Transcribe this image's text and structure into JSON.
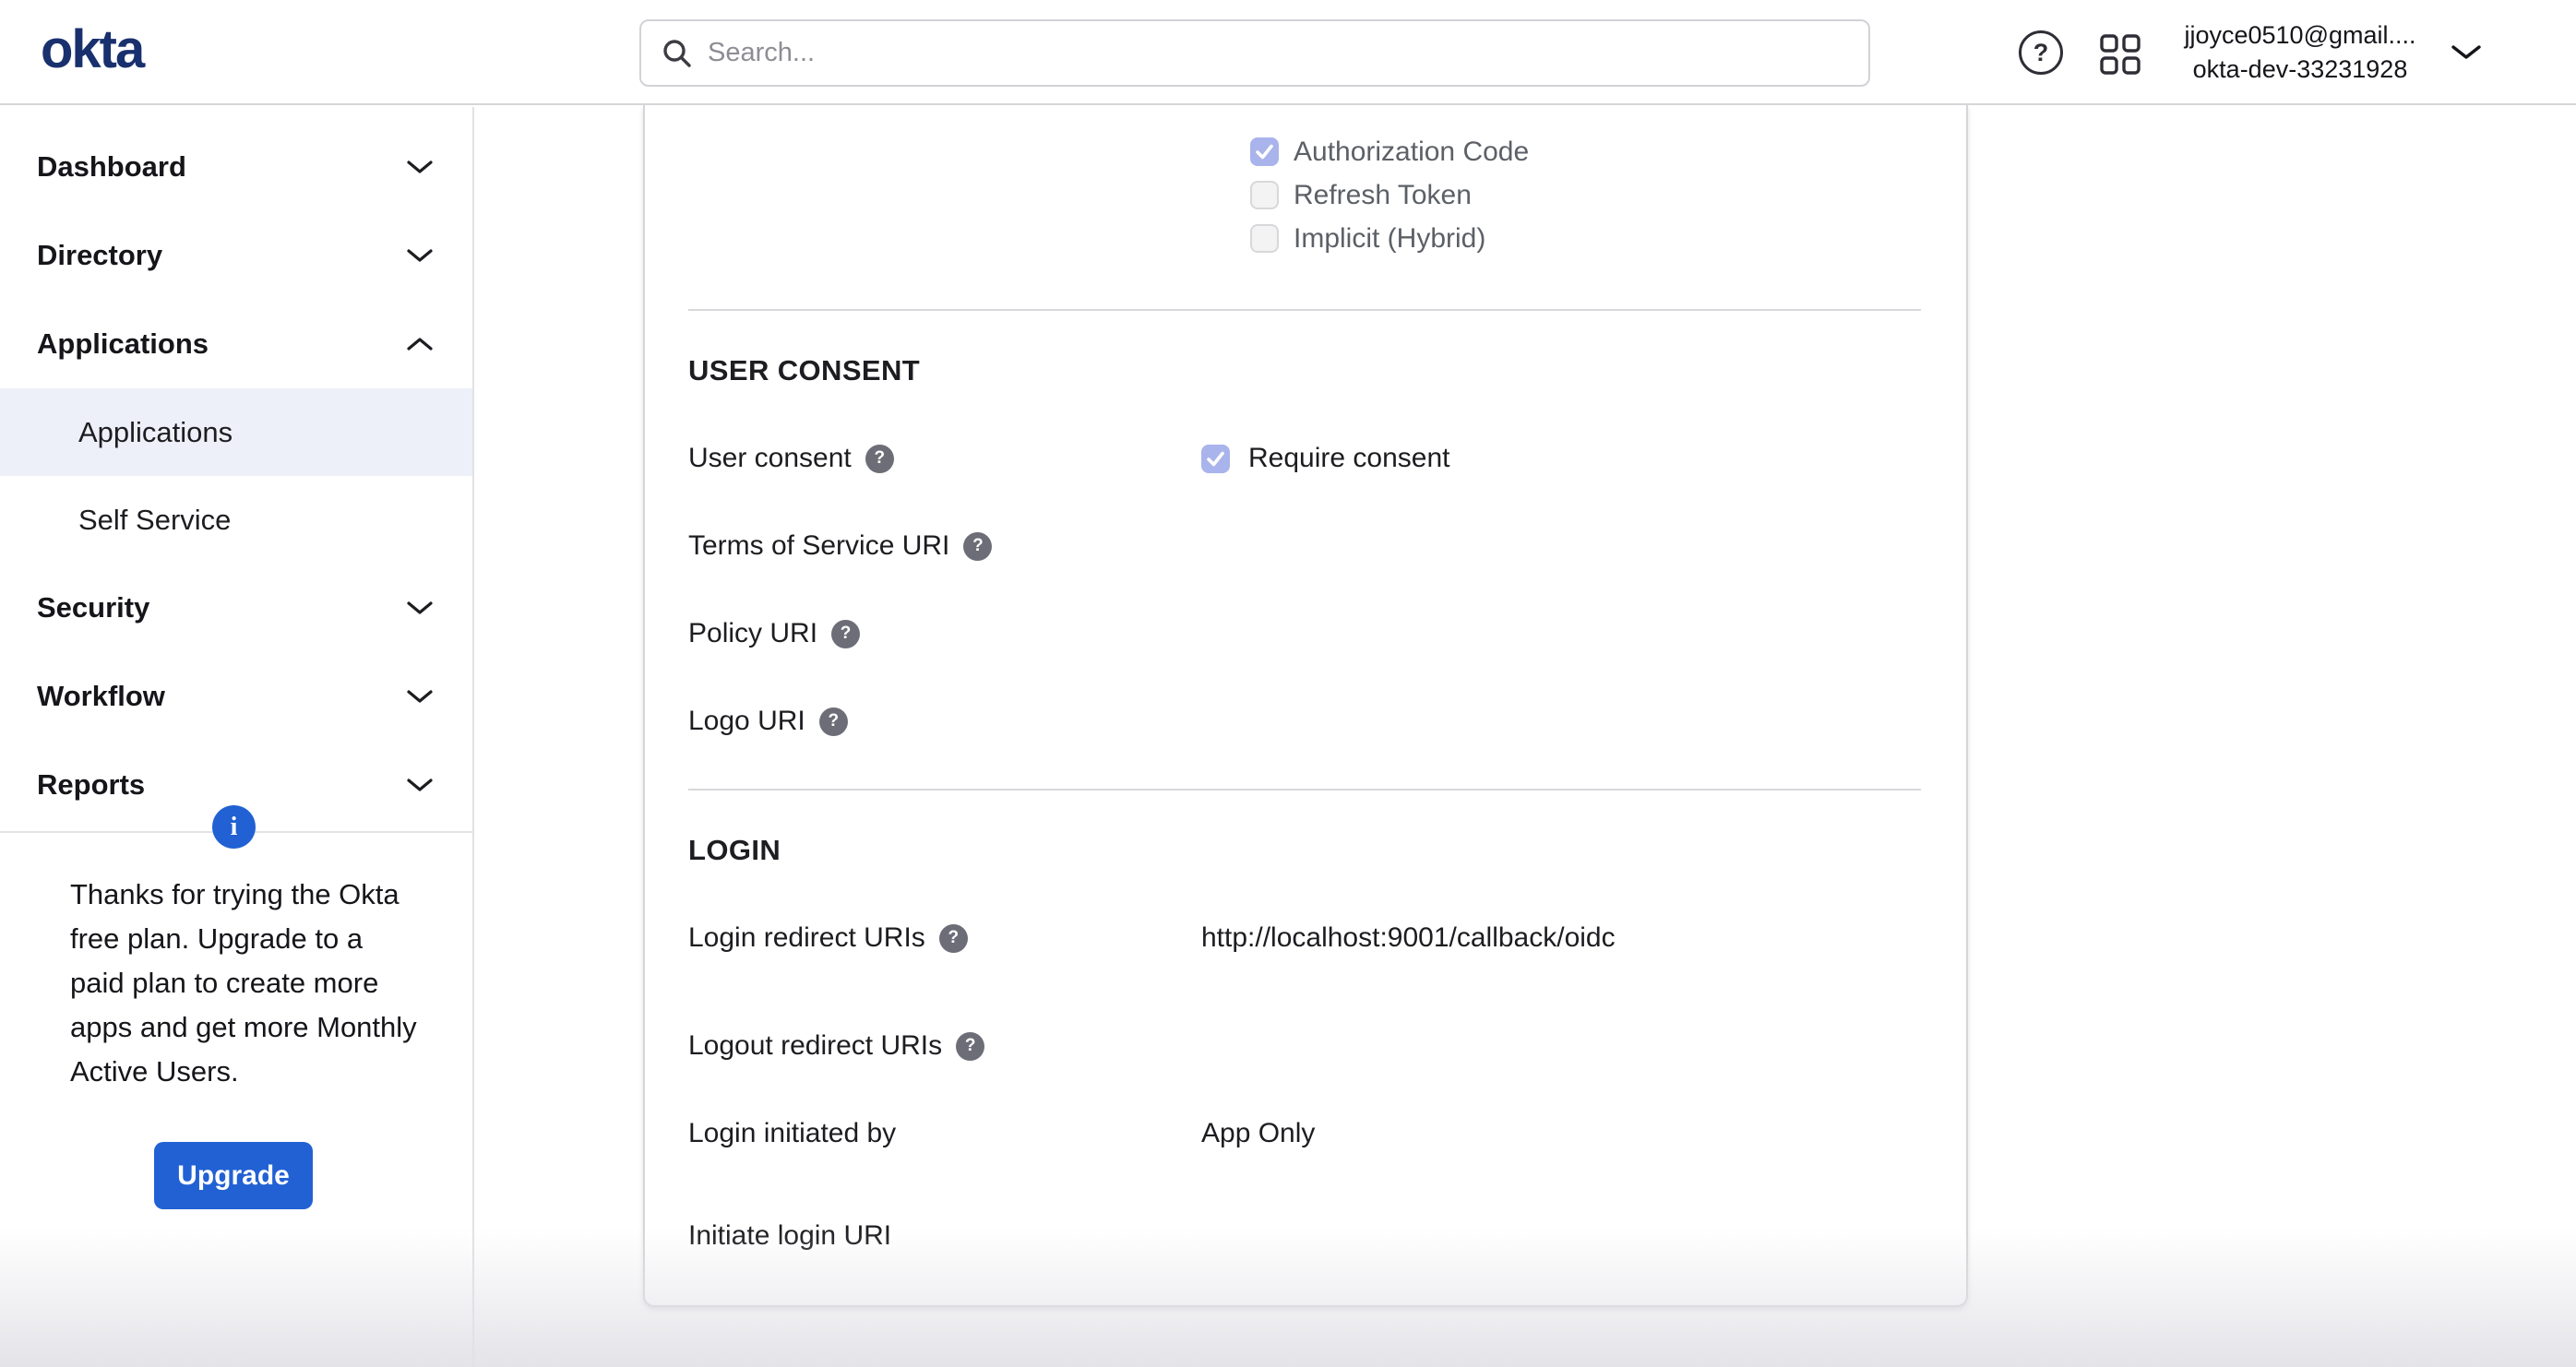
{
  "header": {
    "logo_text": "okta",
    "search_placeholder": "Search...",
    "user_email": "jjoyce0510@gmail....",
    "user_org": "okta-dev-33231928"
  },
  "sidebar": {
    "items": [
      {
        "label": "Dashboard",
        "chevron": "down"
      },
      {
        "label": "Directory",
        "chevron": "down"
      },
      {
        "label": "Applications",
        "chevron": "up",
        "children": [
          {
            "label": "Applications",
            "selected": true
          },
          {
            "label": "Self Service",
            "selected": false
          }
        ]
      },
      {
        "label": "Security",
        "chevron": "down"
      },
      {
        "label": "Workflow",
        "chevron": "down"
      },
      {
        "label": "Reports",
        "chevron": "down"
      }
    ],
    "upsell": {
      "message": "Thanks for trying the Okta free plan. Upgrade to a paid plan to create more apps and get more Monthly Active Users.",
      "button_label": "Upgrade"
    }
  },
  "content": {
    "grant_types": [
      {
        "label": "Authorization Code",
        "checked": true
      },
      {
        "label": "Refresh Token",
        "checked": false
      },
      {
        "label": "Implicit (Hybrid)",
        "checked": false
      }
    ],
    "sections": [
      {
        "title": "USER CONSENT",
        "rows": [
          {
            "label": "User consent",
            "help": true,
            "type": "checkbox",
            "checkbox_label": "Require consent",
            "checked": true
          },
          {
            "label": "Terms of Service URI",
            "help": true,
            "type": "text",
            "value": ""
          },
          {
            "label": "Policy URI",
            "help": true,
            "type": "text",
            "value": ""
          },
          {
            "label": "Logo URI",
            "help": true,
            "type": "text",
            "value": ""
          }
        ]
      },
      {
        "title": "LOGIN",
        "rows": [
          {
            "label": "Login redirect URIs",
            "help": true,
            "type": "text",
            "value": "http://localhost:9001/callback/oidc"
          },
          {
            "label": "Logout redirect URIs",
            "help": true,
            "type": "text",
            "value": ""
          },
          {
            "label": "Login initiated by",
            "help": false,
            "type": "text",
            "value": "App Only"
          },
          {
            "label": "Initiate login URI",
            "help": false,
            "type": "text",
            "value": ""
          }
        ]
      }
    ]
  },
  "colors": {
    "accent_blue": "#2161d3",
    "checkbox_checked": "#a9b4ec",
    "logo_navy": "#19306e",
    "selected_nav_bg": "#eef0f9",
    "help_dot_gray": "#6d6d78"
  }
}
